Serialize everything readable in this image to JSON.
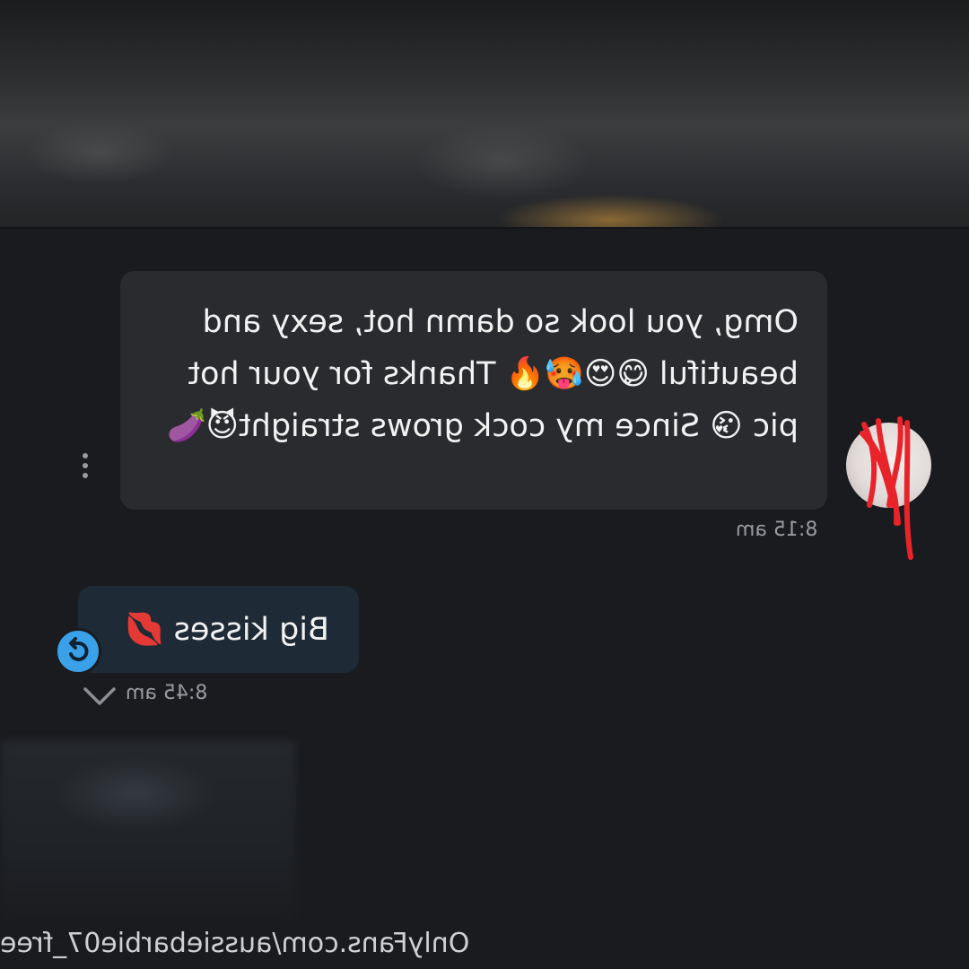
{
  "conversation": {
    "messages": [
      {
        "text": "Omg, you look so damn hot, sexy and beautiful 😋😍🥵🔥 Thanks for your hot pic 😘 Since my cock grows straight😈🍆",
        "time": "8:15 am"
      },
      {
        "text": "Big kisses 💋",
        "time": "8:45 am"
      }
    ]
  },
  "watermark": "OnlyFans.com/aussiebarbie07_free",
  "icons": [
    "more-vert-icon",
    "share-icon",
    "chevron-down-icon"
  ],
  "colors": {
    "background": "#1a1b1f",
    "received_bubble": "#2a2b2f",
    "sent_bubble": "#1e2a35",
    "accent": "#3aa0e8",
    "redaction": "#e8242a"
  }
}
